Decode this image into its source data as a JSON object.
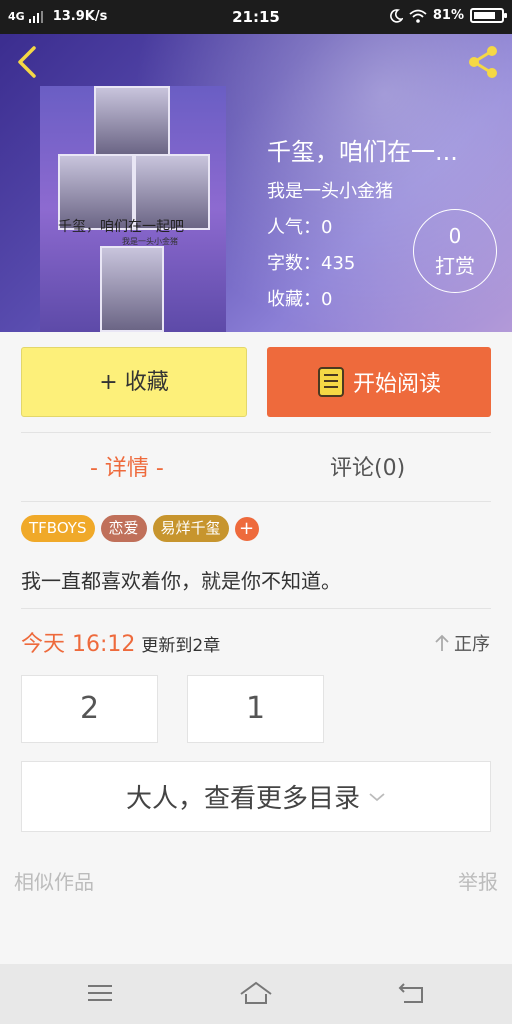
{
  "status_bar": {
    "network": "4G",
    "speed": "13.9K/s",
    "time": "21:15",
    "battery": "81%",
    "battery_level": 0.81
  },
  "book": {
    "title": "千玺，咱们在一...",
    "author": "我是一头小金猪",
    "popularity": "人气：0",
    "word_count": "字数：435",
    "favorites": "收藏：0",
    "cover_text": "千玺，咱们在一起吧",
    "cover_sub": "我是一头小金猪"
  },
  "tip": {
    "count": "0",
    "label": "打赏"
  },
  "actions": {
    "favorite_label": "+ 收藏",
    "read_label": "开始阅读"
  },
  "tabs": {
    "detail": "- 详情 -",
    "comments": "评论(0)"
  },
  "tags": [
    {
      "label": "TFBOYS",
      "color": "#f0a929"
    },
    {
      "label": "恋爱",
      "color": "#c0705a"
    },
    {
      "label": "易烊千玺",
      "color": "#c7952e"
    }
  ],
  "tag_add": "+",
  "intro": "我一直都喜欢着你，就是你不知道。",
  "update": {
    "date": "今天 16:12",
    "chapter": "更新到2章",
    "order": "正序"
  },
  "chapters": [
    "2",
    "1"
  ],
  "more_catalog": "大人，查看更多目录",
  "similar": "相似作品",
  "report": "举报",
  "colors": {
    "accent": "#ee6a3c",
    "favorite_bg": "#fdf07a"
  }
}
